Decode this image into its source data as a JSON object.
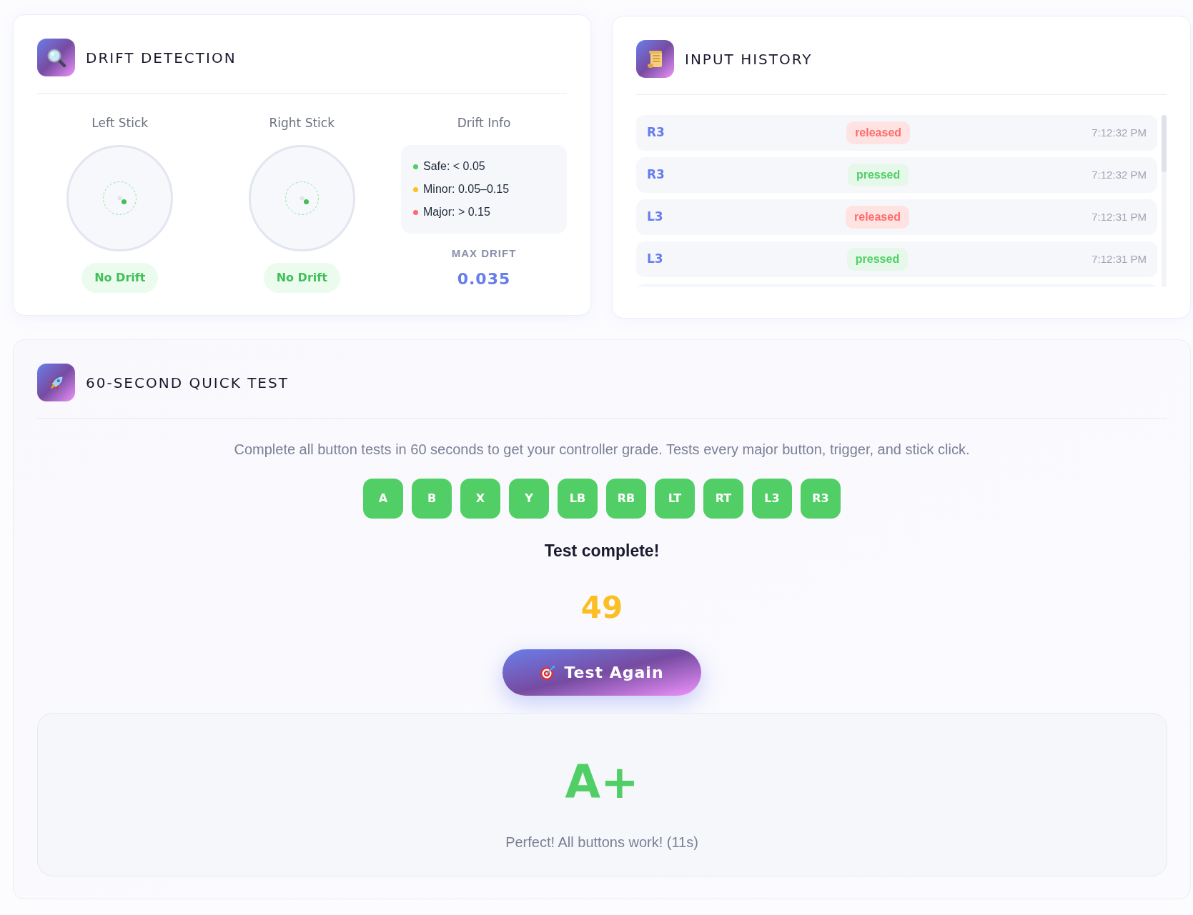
{
  "drift_detection": {
    "title": "DRIFT DETECTION",
    "sticks": [
      {
        "label": "Left Stick",
        "status": "No Drift",
        "drifting": false
      },
      {
        "label": "Right Stick",
        "status": "No Drift",
        "drifting": false
      }
    ],
    "drift_info": {
      "label": "Drift Info",
      "legend": [
        {
          "text": "Safe: < 0.05",
          "color": "#51cf66"
        },
        {
          "text": "Minor: 0.05–0.15",
          "color": "#fcc419"
        },
        {
          "text": "Major: > 0.15",
          "color": "#ff6b6b"
        }
      ],
      "max_drift_label": "MAX DRIFT",
      "max_drift_value": "0.035"
    }
  },
  "input_history": {
    "title": "INPUT HISTORY",
    "events": [
      {
        "button": "R3",
        "action": "released",
        "kind": "released",
        "time": "7:12:32 PM"
      },
      {
        "button": "R3",
        "action": "pressed",
        "kind": "pressed",
        "time": "7:12:32 PM"
      },
      {
        "button": "L3",
        "action": "released",
        "kind": "released",
        "time": "7:12:31 PM"
      },
      {
        "button": "L3",
        "action": "pressed",
        "kind": "pressed",
        "time": "7:12:31 PM"
      }
    ]
  },
  "quick_test": {
    "title": "60-SECOND QUICK TEST",
    "description": "Complete all button tests in 60 seconds to get your controller grade. Tests every major button, trigger, and stick click.",
    "buttons": [
      {
        "label": "A",
        "passed": true
      },
      {
        "label": "B",
        "passed": true
      },
      {
        "label": "X",
        "passed": true
      },
      {
        "label": "Y",
        "passed": true
      },
      {
        "label": "LB",
        "passed": true
      },
      {
        "label": "RB",
        "passed": true
      },
      {
        "label": "LT",
        "passed": true
      },
      {
        "label": "RT",
        "passed": true
      },
      {
        "label": "L3",
        "passed": true
      },
      {
        "label": "R3",
        "passed": true
      }
    ],
    "status": "Test complete!",
    "score": "49",
    "action_button": "Test Again",
    "result": {
      "grade": "A+",
      "message": "Perfect! All buttons work! (11s)"
    }
  }
}
